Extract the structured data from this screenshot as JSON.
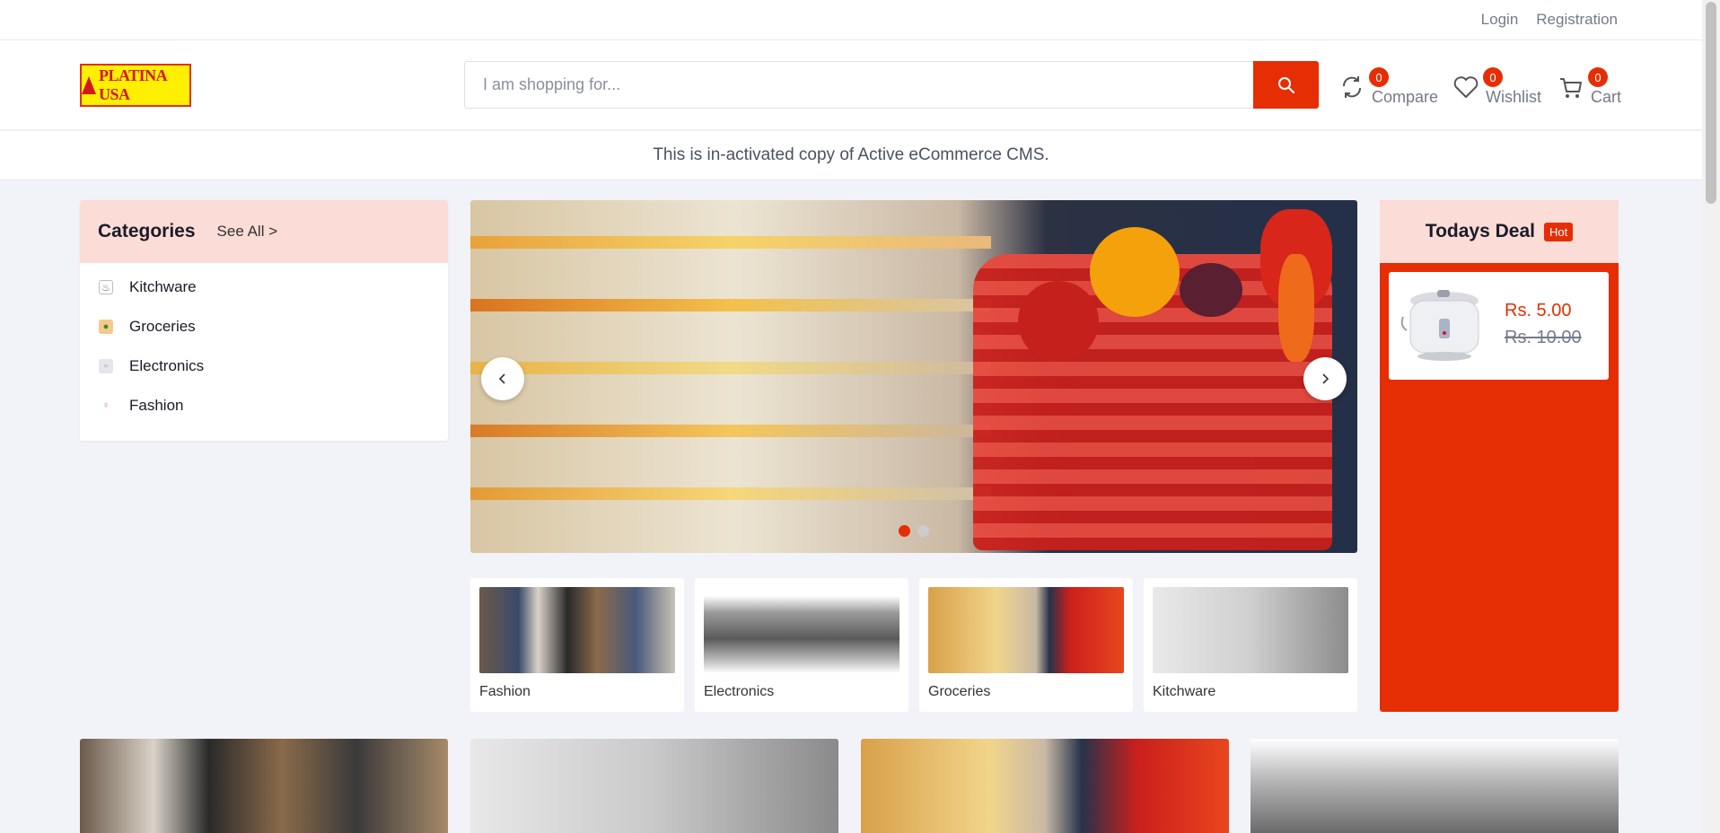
{
  "toplinks": {
    "login": "Login",
    "registration": "Registration"
  },
  "header": {
    "logo_text": "PLATINA USA",
    "search_placeholder": "I am shopping for...",
    "compare": {
      "label": "Compare",
      "count": "0"
    },
    "wishlist": {
      "label": "Wishlist",
      "count": "0"
    },
    "cart": {
      "label": "Cart",
      "count": "0"
    }
  },
  "notice": "This is in-activated copy of Active eCommerce CMS.",
  "categories": {
    "title": "Categories",
    "see_all": "See All >",
    "items": [
      {
        "label": "Kitchware",
        "icon": "chef-hat-icon"
      },
      {
        "label": "Groceries",
        "icon": "grocery-bag-icon"
      },
      {
        "label": "Electronics",
        "icon": "electronics-icon"
      },
      {
        "label": "Fashion",
        "icon": "fashion-icon"
      }
    ]
  },
  "slider": {
    "slides": 2,
    "active": 1
  },
  "tiles": [
    {
      "label": "Fashion"
    },
    {
      "label": "Electronics"
    },
    {
      "label": "Groceries"
    },
    {
      "label": "Kitchware"
    }
  ],
  "deal": {
    "title": "Todays Deal",
    "badge": "Hot",
    "price": "Rs. 5.00",
    "old_price": "Rs. 10.00"
  },
  "colors": {
    "accent": "#e62e04",
    "accent_light": "#fbdcd7"
  }
}
